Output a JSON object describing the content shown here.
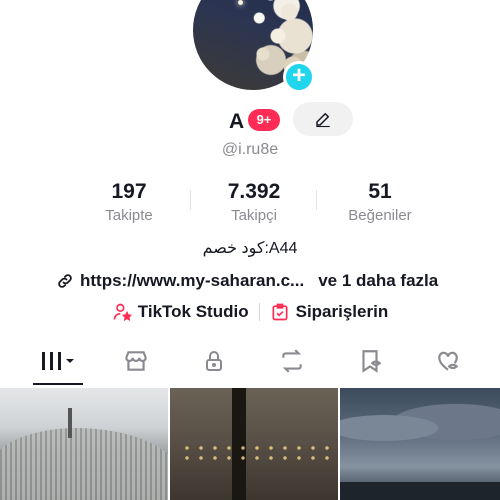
{
  "profile": {
    "name": "A",
    "notification_badge": "9+",
    "handle": "@i.ru8e",
    "bio": "كود خصم:A44",
    "link": "https://www.my-saharan.c...",
    "link_more": "ve 1 daha fazla"
  },
  "stats": [
    {
      "value": "197",
      "label": "Takipte"
    },
    {
      "value": "7.392",
      "label": "Takipçi"
    },
    {
      "value": "51",
      "label": "Beğeniler"
    }
  ],
  "shortcuts": {
    "studio_label": "TikTok Studio",
    "orders_label": "Siparişlerin"
  },
  "tabs": [
    {
      "name": "videos",
      "icon": "grid-icon",
      "active": true
    },
    {
      "name": "shop",
      "icon": "shop-icon",
      "active": false
    },
    {
      "name": "private",
      "icon": "lock-icon",
      "active": false
    },
    {
      "name": "reposts",
      "icon": "repost-icon",
      "active": false
    },
    {
      "name": "favorites",
      "icon": "bookmark-icon",
      "active": false
    },
    {
      "name": "liked",
      "icon": "heart-hidden-icon",
      "active": false
    }
  ],
  "colors": {
    "accent": "#fe2c55",
    "add_button": "#20d5ec",
    "text": "#161823",
    "muted": "#8a8b91"
  }
}
